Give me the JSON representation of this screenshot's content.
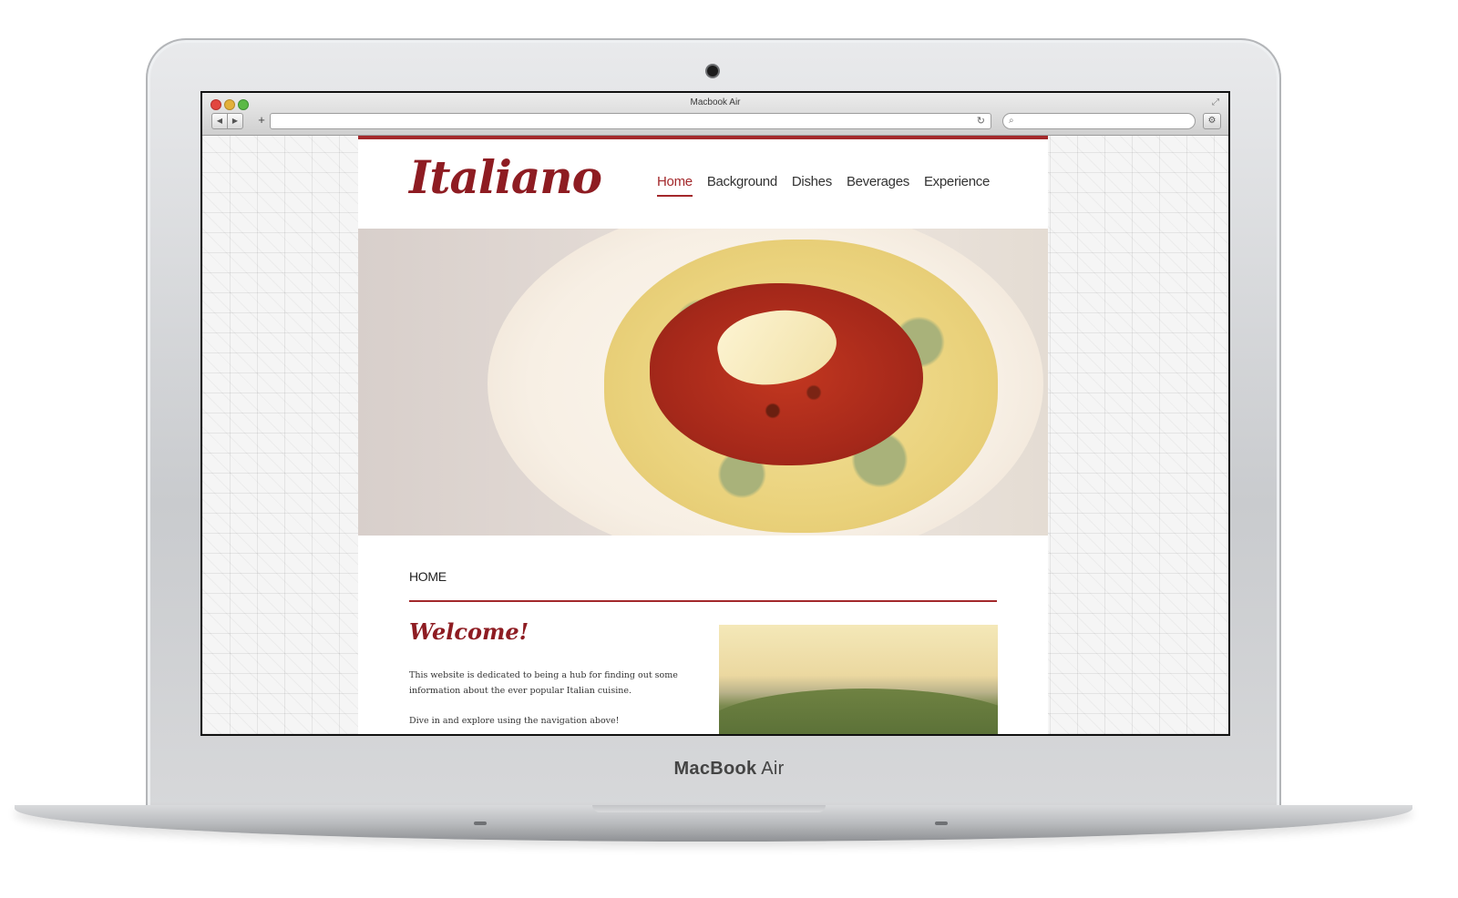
{
  "window": {
    "title": "Macbook Air"
  },
  "browser": {
    "back_glyph": "◀",
    "forward_glyph": "▶",
    "add_tab_glyph": "+",
    "reload_glyph": "↻",
    "search_glyph": "⌕",
    "settings_glyph": "⚙",
    "fullscreen_glyph": "⤢",
    "address": "",
    "search": ""
  },
  "site": {
    "logo": "Italiano",
    "nav": [
      {
        "label": "Home",
        "active": true
      },
      {
        "label": "Background",
        "active": false
      },
      {
        "label": "Dishes",
        "active": false
      },
      {
        "label": "Beverages",
        "active": false
      },
      {
        "label": "Experience",
        "active": false
      }
    ],
    "section_heading": "HOME",
    "welcome": "Welcome!",
    "intro": "This website is dedicated to being a hub for finding out some information about the ever popular Italian cuisine.",
    "explore": "Dive in and explore using the navigation above!"
  },
  "device": {
    "brand": "MacBook",
    "model": "Air"
  },
  "colors": {
    "accent": "#a3282b",
    "logo": "#8e1c22"
  }
}
